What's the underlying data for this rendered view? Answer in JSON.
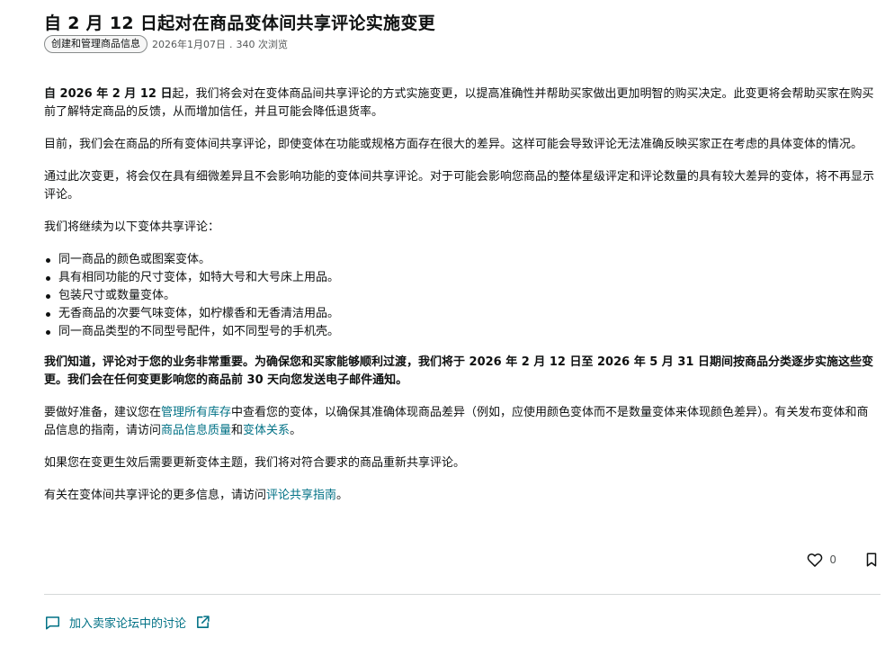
{
  "article": {
    "title": "自 2 月 12 日起对在商品变体间共享评论实施变更",
    "category": "创建和管理商品信息",
    "date": "2026年1月07日",
    "separator": ".",
    "views": "340 次浏览"
  },
  "body": {
    "p1_bold": "自 2026 年 2 月 12 日",
    "p1_rest": "起，我们将会对在变体商品间共享评论的方式实施变更，以提高准确性并帮助买家做出更加明智的购买决定。此变更将会帮助买家在购买前了解特定商品的反馈，从而增加信任，并且可能会降低退货率。",
    "p2": "目前，我们会在商品的所有变体间共享评论，即使变体在功能或规格方面存在很大的差异。这样可能会导致评论无法准确反映买家正在考虑的具体变体的情况。",
    "p3": "通过此次变更，将会仅在具有细微差异且不会影响功能的变体间共享评论。对于可能会影响您商品的整体星级评定和评论数量的具有较大差异的变体，将不再显示评论。",
    "p4": "我们将继续为以下变体共享评论：",
    "list": [
      "同一商品的颜色或图案变体。",
      "具有相同功能的尺寸变体，如特大号和大号床上用品。",
      "包装尺寸或数量变体。",
      "无香商品的次要气味变体，如柠檬香和无香清洁用品。",
      "同一商品类型的不同型号配件，如不同型号的手机壳。"
    ],
    "p5_bold": "我们知道，评论对于您的业务非常重要。为确保您和买家能够顺利过渡，我们将于 2026 年 2 月 12 日至 2026 年 5 月 31 日期间按商品分类逐步实施这些变更。我们会在任何变更影响您的商品前 30 天向您发送电子邮件通知。",
    "p6_a": "要做好准备，建议您在",
    "p6_link1": "管理所有库存",
    "p6_b": "中查看您的变体，以确保其准确体现商品差异（例如，应使用颜色变体而不是数量变体来体现颜色差异）。有关发布变体和商品信息的指南，请访问",
    "p6_link2": "商品信息质量",
    "p6_c": "和",
    "p6_link3": "变体关系",
    "p6_d": "。",
    "p7": "如果您在变更生效后需要更新变体主题，我们将对符合要求的商品重新共享评论。",
    "p8_a": "有关在变体间共享评论的更多信息，请访问",
    "p8_link": "评论共享指南",
    "p8_b": "。"
  },
  "actions": {
    "like_count": "0"
  },
  "forum": {
    "label": "加入卖家论坛中的讨论"
  },
  "colors": {
    "link": "#007185",
    "text": "#0f1111",
    "muted": "#565959",
    "divider": "#d5d9d9"
  },
  "icons": {
    "like": "heart-icon",
    "bookmark": "bookmark-icon",
    "forum": "chat-bubble-icon",
    "external": "external-link-icon"
  }
}
